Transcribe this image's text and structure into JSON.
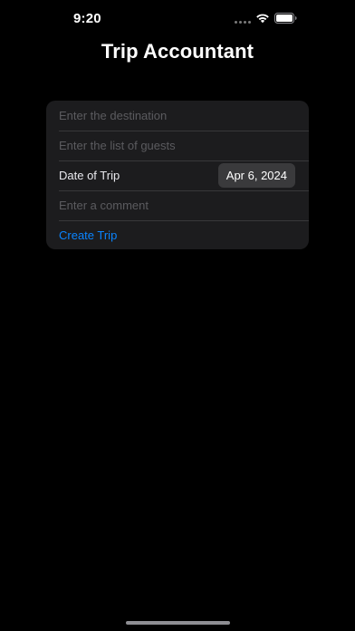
{
  "status_bar": {
    "time": "9:20"
  },
  "header": {
    "title": "Trip Accountant"
  },
  "form": {
    "destination_placeholder": "Enter the destination",
    "destination_value": "",
    "guests_placeholder": "Enter the list of guests",
    "guests_value": "",
    "date_label": "Date of Trip",
    "date_value": "Apr 6, 2024",
    "comment_placeholder": "Enter a comment",
    "comment_value": "",
    "create_label": "Create Trip"
  },
  "colors": {
    "background": "#000000",
    "card": "#1c1c1e",
    "accent": "#0a84ff",
    "placeholder": "#5b5b5f",
    "date_chip": "#3a3a3c"
  },
  "icons": {
    "signal": "cellular-signal-icon",
    "wifi": "wifi-icon",
    "battery": "battery-icon"
  }
}
